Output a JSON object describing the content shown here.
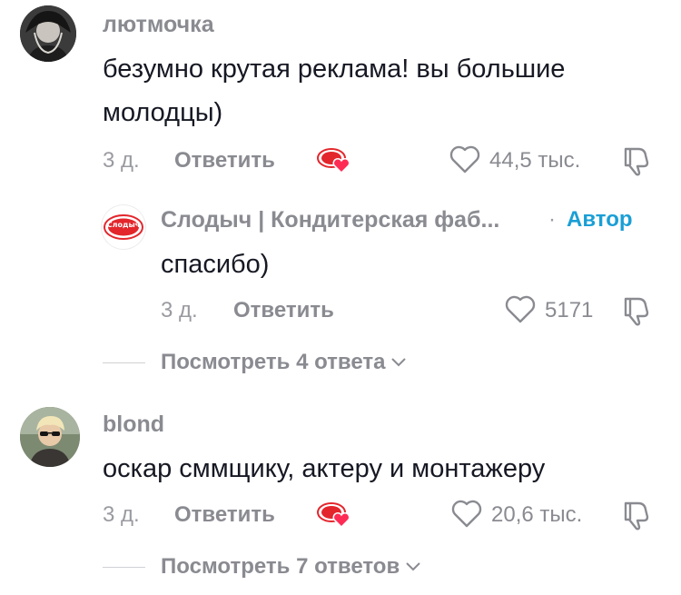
{
  "comments": [
    {
      "username": "лютмочка",
      "text": "безумно крутая реклама! вы большие молодцы)",
      "time": "3 д.",
      "reply_label": "Ответить",
      "likes": "44,5 тыс.",
      "liked_by_creator": true,
      "avatar_icon": "dark-character-avatar"
    },
    {
      "username": "blond",
      "text": "оскар сммщику, актеру и монтажеру",
      "time": "3 д.",
      "reply_label": "Ответить",
      "likes": "20,6 тыс.",
      "liked_by_creator": true,
      "avatar_icon": "person-sunglasses-avatar"
    }
  ],
  "reply": {
    "username": "Слодыч | Кондитерская фаб...",
    "separator": "·",
    "author_label": "Автор",
    "text": "спасибо)",
    "time": "3 д.",
    "reply_label": "Ответить",
    "likes": "5171",
    "logo_text": "Слодыч"
  },
  "view_more": [
    {
      "label": "Посмотреть 4 ответа"
    },
    {
      "label": "Посмотреть 7 ответов"
    }
  ],
  "colors": {
    "text": "#161823",
    "muted": "#8a8b91",
    "author": "#1a9fd5",
    "brand_red": "#e3262c",
    "heart_pink": "#fe2c55"
  }
}
